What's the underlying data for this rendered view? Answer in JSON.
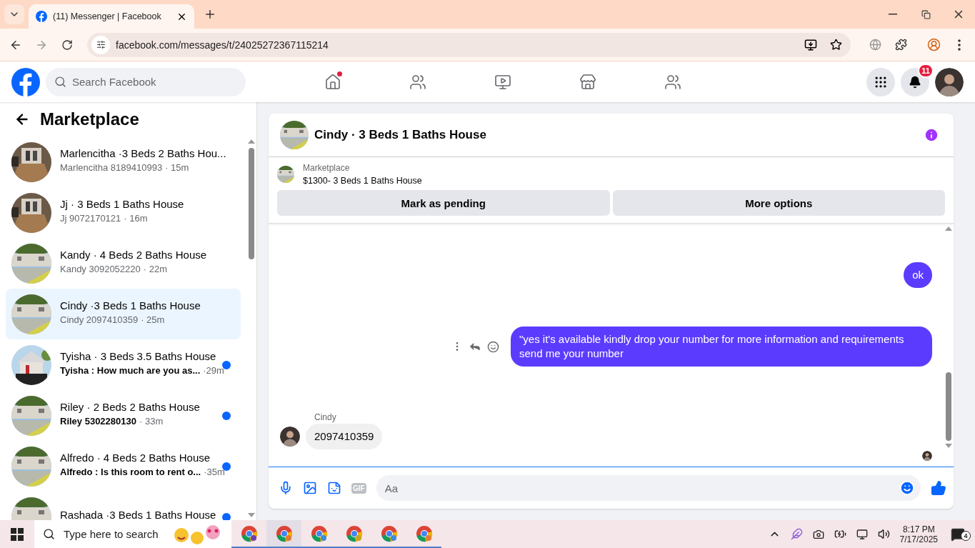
{
  "browser": {
    "tab_title": "(11) Messenger | Facebook",
    "url": "facebook.com/messages/t/24025272367115214"
  },
  "header": {
    "search_placeholder": "Search Facebook",
    "nav": [
      {
        "kind": "home",
        "badge": true
      },
      {
        "kind": "friends",
        "badge": false
      },
      {
        "kind": "video",
        "badge": false
      },
      {
        "kind": "marketplace",
        "badge": false
      },
      {
        "kind": "groups",
        "badge": false
      }
    ],
    "notification_count": "11"
  },
  "sidebar": {
    "title": "Marketplace",
    "conversations": [
      {
        "title": "Marlencitha ·3 Beds 2 Baths Hou...",
        "preview": "Marlencitha 8189410993",
        "time": "· 15m",
        "selected": false,
        "unread": false
      },
      {
        "title": "Jj · 3 Beds 1 Baths House",
        "preview": "Jj 9072170121",
        "time": "· 16m",
        "selected": false,
        "unread": false
      },
      {
        "title": "Kandy · 4 Beds 2 Baths House",
        "preview": "Kandy 3092052220",
        "time": "· 22m",
        "selected": false,
        "unread": false
      },
      {
        "title": "Cindy ·3 Beds 1 Baths House",
        "preview": "Cindy 2097410359",
        "time": "· 25m",
        "selected": true,
        "unread": false
      },
      {
        "title": "Tyisha · 3 Beds 3.5 Baths House",
        "preview": "Tyisha : How much are you as...",
        "time": "·29m",
        "selected": false,
        "unread": true
      },
      {
        "title": "Riley · 2 Beds 2 Baths House",
        "preview": "Riley 5302280130",
        "time": "· 33m",
        "selected": false,
        "unread": true
      },
      {
        "title": "Alfredo · 4 Beds 2 Baths House",
        "preview": "Alfredo : Is this room to rent o...",
        "time": "·35m",
        "selected": false,
        "unread": true
      },
      {
        "title": "Rashada ·3 Beds 1 Baths House",
        "selected": false,
        "unread": true
      }
    ]
  },
  "chat": {
    "title": "Cindy · 3 Beds 1 Baths House",
    "listing_label": "Marketplace",
    "listing": "$1300- 3 Beds 1 Baths House",
    "buttons": [
      "Mark as pending",
      "More options"
    ],
    "messages": [
      {
        "kind": "sent",
        "text": "ok"
      },
      {
        "kind": "sent",
        "text": "\"yes it's available kindly drop your number for more information and requirements send me your number"
      },
      {
        "kind": "received",
        "sender": "Cindy",
        "text": "2097410359"
      }
    ],
    "composer": {
      "placeholder": "Aa",
      "gif_label": "GIF"
    }
  },
  "taskbar": {
    "search_placeholder": "Type here to search",
    "time": "8:17 PM",
    "date": "7/17/2025",
    "notification_count": "4"
  }
}
